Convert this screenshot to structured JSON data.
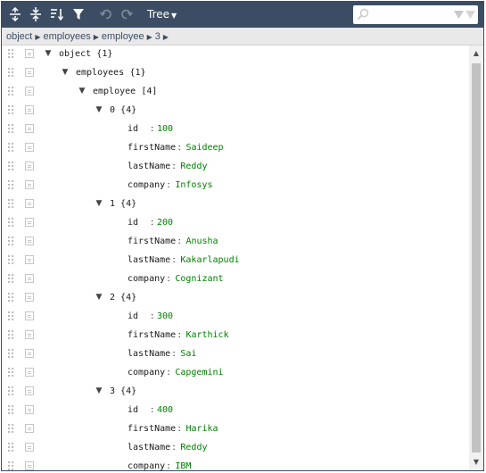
{
  "toolbar": {
    "buttons": [
      {
        "name": "expand-all-button",
        "icon": "expand-all-icon"
      },
      {
        "name": "collapse-all-button",
        "icon": "collapse-all-icon"
      },
      {
        "name": "sort-button",
        "icon": "sort-icon"
      },
      {
        "name": "filter-button",
        "icon": "filter-icon"
      },
      {
        "name": "undo-button",
        "icon": "undo-icon",
        "disabled": true
      },
      {
        "name": "redo-button",
        "icon": "redo-icon",
        "disabled": true
      }
    ],
    "mode_label": "Tree",
    "search_placeholder": ""
  },
  "breadcrumb": [
    "object",
    "employees",
    "employee",
    "3"
  ],
  "colors": {
    "menu_bg": "#3c4d63",
    "value_text": "#008000",
    "nav_bg": "#e9e9e9"
  },
  "tree": [
    {
      "type": "node",
      "indent": 0,
      "field": "object",
      "count": "{1}"
    },
    {
      "type": "node",
      "indent": 1,
      "field": "employees",
      "count": "{1}"
    },
    {
      "type": "node",
      "indent": 2,
      "field": "employee",
      "count": "[4]"
    },
    {
      "type": "node",
      "indent": 3,
      "field": "0",
      "count": "{4}"
    },
    {
      "type": "leaf",
      "indent": 4,
      "field": "id",
      "value": "100"
    },
    {
      "type": "leaf",
      "indent": 4,
      "field": "firstName",
      "value": "Saideep"
    },
    {
      "type": "leaf",
      "indent": 4,
      "field": "lastName",
      "value": "Reddy"
    },
    {
      "type": "leaf",
      "indent": 4,
      "field": "company",
      "value": "Infosys"
    },
    {
      "type": "node",
      "indent": 3,
      "field": "1",
      "count": "{4}"
    },
    {
      "type": "leaf",
      "indent": 4,
      "field": "id",
      "value": "200"
    },
    {
      "type": "leaf",
      "indent": 4,
      "field": "firstName",
      "value": "Anusha"
    },
    {
      "type": "leaf",
      "indent": 4,
      "field": "lastName",
      "value": "Kakarlapudi"
    },
    {
      "type": "leaf",
      "indent": 4,
      "field": "company",
      "value": "Cognizant"
    },
    {
      "type": "node",
      "indent": 3,
      "field": "2",
      "count": "{4}"
    },
    {
      "type": "leaf",
      "indent": 4,
      "field": "id",
      "value": "300"
    },
    {
      "type": "leaf",
      "indent": 4,
      "field": "firstName",
      "value": "Karthick"
    },
    {
      "type": "leaf",
      "indent": 4,
      "field": "lastName",
      "value": "Sai"
    },
    {
      "type": "leaf",
      "indent": 4,
      "field": "company",
      "value": "Capgemini"
    },
    {
      "type": "node",
      "indent": 3,
      "field": "3",
      "count": "{4}"
    },
    {
      "type": "leaf",
      "indent": 4,
      "field": "id",
      "value": "400"
    },
    {
      "type": "leaf",
      "indent": 4,
      "field": "firstName",
      "value": "Harika"
    },
    {
      "type": "leaf",
      "indent": 4,
      "field": "lastName",
      "value": "Reddy"
    },
    {
      "type": "leaf",
      "indent": 4,
      "field": "company",
      "value": "IBM"
    }
  ]
}
